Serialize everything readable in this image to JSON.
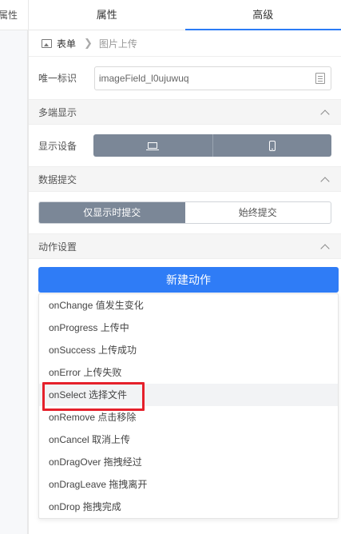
{
  "left_panel": {
    "tab_label": "属性"
  },
  "tabs": [
    {
      "label": "属性",
      "active": false
    },
    {
      "label": "高级",
      "active": true
    }
  ],
  "breadcrumb": {
    "parent": "表单",
    "current": "图片上传",
    "icon": "image-icon"
  },
  "unique_id": {
    "label": "唯一标识",
    "value": "imageField_l0ujuwuq",
    "icon": "copy-icon"
  },
  "multi_display": {
    "title": "多端显示",
    "label": "显示设备",
    "devices": [
      "laptop-icon",
      "phone-icon"
    ]
  },
  "data_submit": {
    "title": "数据提交",
    "options": [
      {
        "label": "仅显示时提交",
        "selected": true
      },
      {
        "label": "始终提交",
        "selected": false
      }
    ]
  },
  "actions": {
    "title": "动作设置",
    "new_button": "新建动作",
    "items": [
      {
        "label": "onChange 值发生变化"
      },
      {
        "label": "onProgress 上传中"
      },
      {
        "label": "onSuccess 上传成功"
      },
      {
        "label": "onError 上传失败"
      },
      {
        "label": "onSelect 选择文件",
        "highlighted": true
      },
      {
        "label": "onRemove 点击移除"
      },
      {
        "label": "onCancel 取消上传"
      },
      {
        "label": "onDragOver 拖拽经过"
      },
      {
        "label": "onDragLeave 拖拽离开"
      },
      {
        "label": "onDrop 拖拽完成"
      }
    ]
  },
  "colors": {
    "accent": "#2f7cf6",
    "segment_dark": "#7b8797",
    "highlight_box": "#e5202b",
    "section_bg": "#f5f5f5"
  }
}
